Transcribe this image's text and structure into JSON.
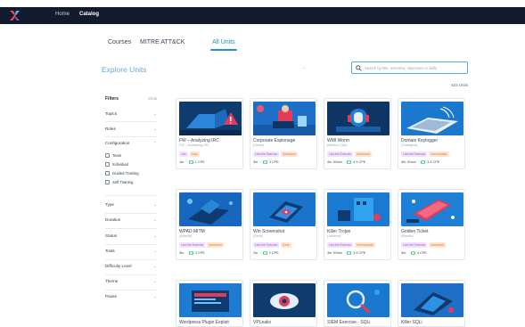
{
  "topbar": {
    "home": "Home",
    "catalog": "Catalog"
  },
  "tabs": [
    {
      "label": "Courses"
    },
    {
      "label": "MITRE ATT&CK"
    },
    {
      "label": "All Units"
    }
  ],
  "header": {
    "title": "Explore Units",
    "dash": "-",
    "search_placeholder": "Search by title, overview, objectives or skills",
    "units_count": "323 Units"
  },
  "filters": {
    "title": "Filters",
    "clear": "Clear",
    "groups": [
      {
        "label": "Topics"
      },
      {
        "label": "Roles"
      },
      {
        "label": "Configuration"
      },
      {
        "label": "Type"
      },
      {
        "label": "Duration"
      },
      {
        "label": "Status"
      },
      {
        "label": "Tools"
      },
      {
        "label": "Difficulty Level"
      },
      {
        "label": "Theme"
      },
      {
        "label": "Pause"
      }
    ],
    "configuration_options": [
      "Team",
      "Individual",
      "Guided Training",
      "Self Training"
    ]
  },
  "colors": {
    "accent": "#1f8fd6",
    "topbar": "#121b2d",
    "card_bg_dark": "#0d2f57",
    "card_bg_light": "#1d8fe0"
  },
  "cards": [
    {
      "title": "FW – Analyzing IRC",
      "sub": "FW – Analyzing IRC",
      "badges": [
        {
          "text": "Lab",
          "c": "purple"
        },
        {
          "text": "Easy",
          "c": "orange"
        }
      ],
      "duration": "1hr",
      "cpe": "1 CPE"
    },
    {
      "title": "Corporate Espionage",
      "sub": "(Seoul)",
      "badges": [
        {
          "text": "Live-fire Exercise",
          "c": "purple"
        },
        {
          "text": "Advanced",
          "c": "orange"
        }
      ],
      "duration": "3hr",
      "cpe": "3 CPE"
    },
    {
      "title": "WMI Worm",
      "sub": "(Mexico City)",
      "badges": [
        {
          "text": "Live-fire Exercise",
          "c": "purple"
        },
        {
          "text": "Advanced",
          "c": "orange"
        }
      ],
      "duration": "4hr 30min",
      "cpe": "4.5 CPE"
    },
    {
      "title": "Domain Keylogger",
      "sub": "(Shanghai)",
      "badges": [
        {
          "text": "Live-fire Exercise",
          "c": "purple"
        },
        {
          "text": "Intermediate",
          "c": "orange"
        }
      ],
      "duration": "3hr 30min",
      "cpe": "3.5 CPE"
    },
    {
      "title": "WPAD MITM",
      "sub": "(Atlanta)",
      "badges": [
        {
          "text": "Live-fire Exercise",
          "c": "purple"
        },
        {
          "text": "Advanced",
          "c": "orange"
        }
      ],
      "duration": "3hr",
      "cpe": "3 CPE"
    },
    {
      "title": "Win Screenshot",
      "sub": "(Delhi)",
      "badges": [
        {
          "text": "Live-fire Exercise",
          "c": "purple"
        },
        {
          "text": "Easy",
          "c": "orange"
        }
      ],
      "duration": "2hr",
      "cpe": "2 CPE"
    },
    {
      "title": "Killer Trojan",
      "sub": "(Jakarta)",
      "badges": [
        {
          "text": "Live-fire Exercise",
          "c": "purple"
        },
        {
          "text": "Intermediate",
          "c": "orange"
        }
      ],
      "duration": "3hr 30min",
      "cpe": "3.5 CPE"
    },
    {
      "title": "Golden Ticket",
      "sub": "(Manila)",
      "badges": [
        {
          "text": "Live-fire Exercise",
          "c": "purple"
        },
        {
          "text": "Advanced",
          "c": "orange"
        }
      ],
      "duration": "3hr",
      "cpe": "3 CPE"
    },
    {
      "title": "Wordpress Plugin Exploit",
      "sub": "",
      "badges": [],
      "duration": "",
      "cpe": ""
    },
    {
      "title": "VPLeaks",
      "sub": "",
      "badges": [],
      "duration": "",
      "cpe": ""
    },
    {
      "title": "SIEM Exercise - SQLi",
      "sub": "",
      "badges": [],
      "duration": "",
      "cpe": ""
    },
    {
      "title": "Killer SQLi",
      "sub": "",
      "badges": [],
      "duration": "",
      "cpe": ""
    }
  ]
}
